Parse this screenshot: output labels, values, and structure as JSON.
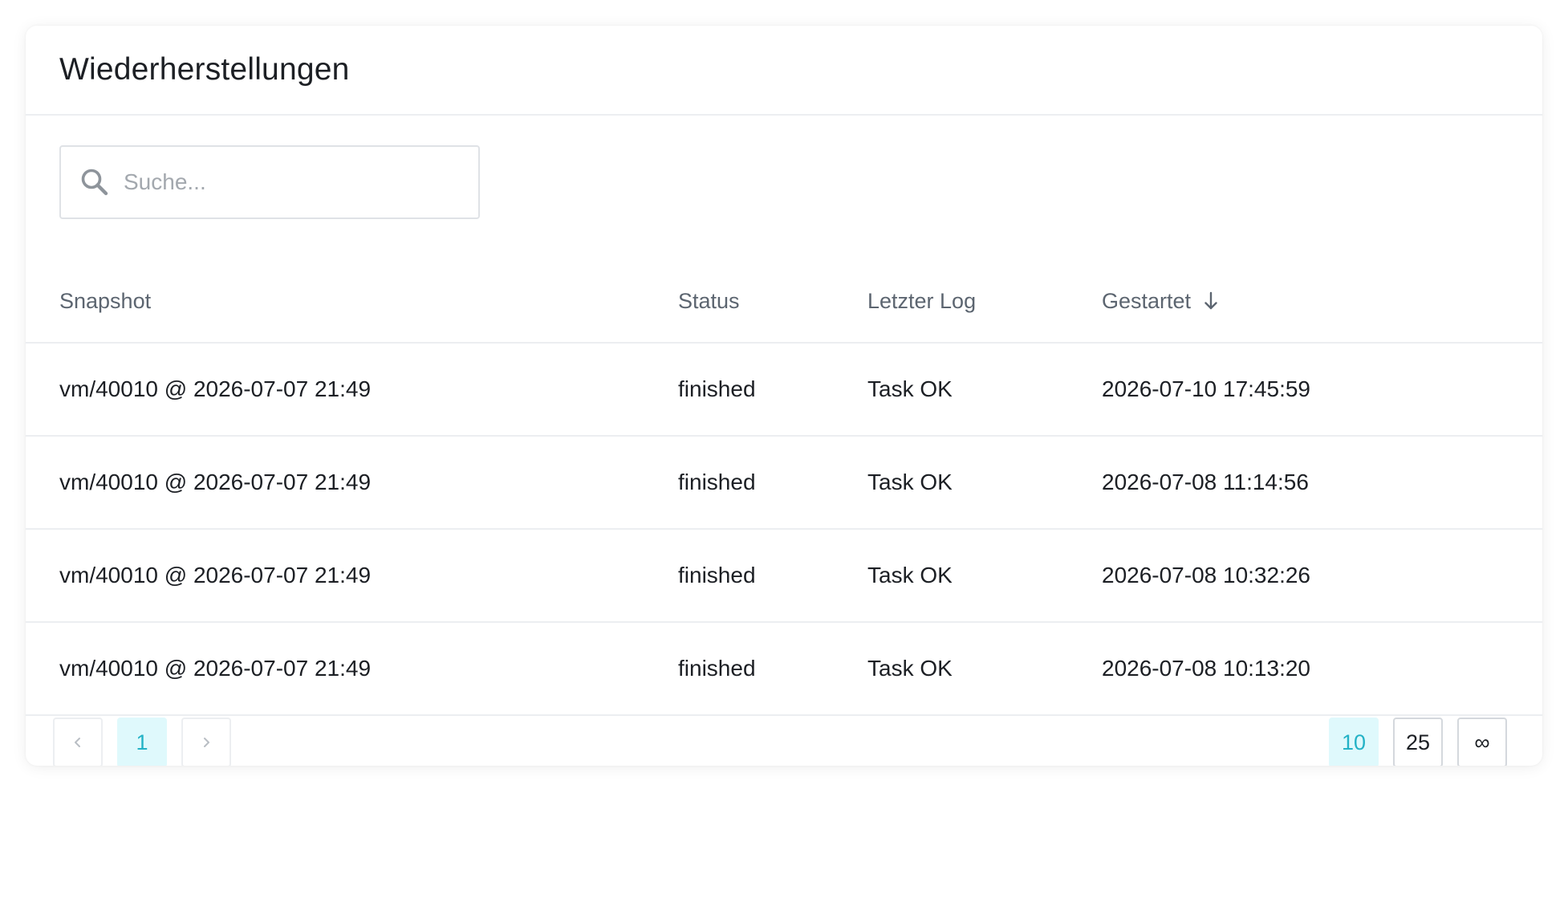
{
  "header": {
    "title": "Wiederherstellungen"
  },
  "search": {
    "placeholder": "Suche...",
    "value": ""
  },
  "table": {
    "columns": {
      "snapshot": "Snapshot",
      "status": "Status",
      "last_log": "Letzter Log",
      "started": "Gestartet"
    },
    "sort": {
      "column": "started",
      "direction": "descending"
    },
    "rows": [
      {
        "snapshot": "vm/40010 @ 2026-07-07 21:49",
        "status": "finished",
        "last_log": "Task OK",
        "started": "2026-07-10 17:45:59"
      },
      {
        "snapshot": "vm/40010 @ 2026-07-07 21:49",
        "status": "finished",
        "last_log": "Task OK",
        "started": "2026-07-08 11:14:56"
      },
      {
        "snapshot": "vm/40010 @ 2026-07-07 21:49",
        "status": "finished",
        "last_log": "Task OK",
        "started": "2026-07-08 10:32:26"
      },
      {
        "snapshot": "vm/40010 @ 2026-07-07 21:49",
        "status": "finished",
        "last_log": "Task OK",
        "started": "2026-07-08 10:13:20"
      }
    ]
  },
  "pagination": {
    "prev_icon": "chevron-left-icon",
    "next_icon": "chevron-right-icon",
    "pages": [
      "1"
    ],
    "current_page": "1",
    "page_sizes": [
      "10",
      "25",
      "∞"
    ],
    "current_page_size": "10"
  },
  "colors": {
    "accent": "#23b2c6",
    "accent_bg": "#dff9fc"
  }
}
